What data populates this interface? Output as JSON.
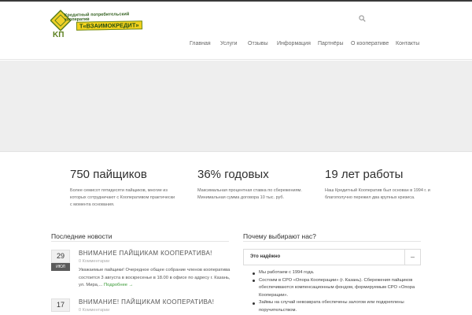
{
  "logo": {
    "line1": "Кредитный потребительский",
    "line2": "кооператив",
    "name": "Т«ВЗАИМОКРЕДИТ»"
  },
  "header": {
    "search_icon": "search-icon"
  },
  "nav": {
    "items": [
      {
        "label": "Главная",
        "active": true
      },
      {
        "label": "Услуги",
        "active": true
      },
      {
        "label": "Отзывы",
        "active": false
      },
      {
        "label": "Информация",
        "active": false
      },
      {
        "label": "Партнёры",
        "active": false
      },
      {
        "label": "О кооперативе",
        "active": false
      },
      {
        "label": "Контакты",
        "active": false
      }
    ]
  },
  "stats": [
    {
      "title": "750 пайщиков",
      "text": "Более семисот пятидесяти пайщиков, многие из которых сотрудничают с Кооперативом практически с момента основания."
    },
    {
      "title": "36% годовых",
      "text": "Максимальная процентная ставка по сбережениям. Минимальная сумма договора 10 тыс. руб."
    },
    {
      "title": "19 лет работы",
      "text": "Наш Кредитный Кооператив был основан в 1994 г. и благополучно пережил два крупных кризиса."
    }
  ],
  "news": {
    "heading": "Последние новости",
    "items": [
      {
        "day": "29",
        "month": "ИЮЛ",
        "title": "ВНИМАНИЕ ПАЙЩИКАМ КООПЕРАТИВА!",
        "comments": "0 Комментарии",
        "excerpt": "Уважаемые пайщики! Очередное общее собрание членов кооператива состоится 3 августа в воскресенье в 18.00 в офисе по адресу г. Казань, ул. Мира,...",
        "more": "Подробнее →"
      },
      {
        "day": "17",
        "month": "",
        "title": "ВНИМАНИЕ! ПАЙЩИКАМ КООПЕРАТИВА!",
        "comments": "0 Комментарии",
        "excerpt": "",
        "more": ""
      }
    ]
  },
  "why": {
    "heading": "Почему выбирают нас?",
    "accordion_title": "Это надёжно",
    "toggle": "–",
    "points": [
      "Мы работаем с 1994 года.",
      "Состоим в СРО «Опора Кооперации» (г. Казань). Сбережения пайщиков обеспечиваются компенсационным фондом, формируемым СРО «Опора Кооперации».",
      "Займы на случай невозврата обеспечены залогом или подкреплены поручительством."
    ]
  },
  "colors": {
    "accent": "#3c7a34",
    "link": "#3a9a36",
    "slider": "#eeeeee"
  }
}
